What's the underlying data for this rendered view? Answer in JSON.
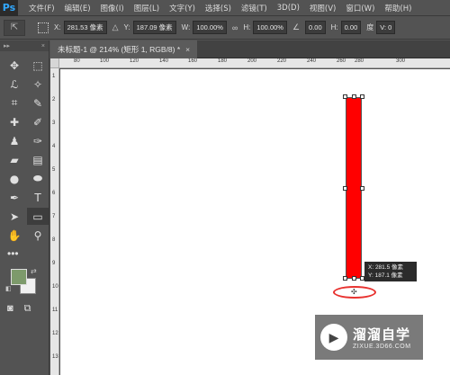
{
  "menubar": {
    "logo": "Ps",
    "items": [
      "文件(F)",
      "编辑(E)",
      "图像(I)",
      "图层(L)",
      "文字(Y)",
      "选择(S)",
      "滤镜(T)",
      "3D(D)",
      "视图(V)",
      "窗口(W)",
      "帮助(H)"
    ]
  },
  "options": {
    "x_label": "X:",
    "x_value": "281.53 像素",
    "delta_icon": "delta-icon",
    "y_label": "Y:",
    "y_value": "187.09 像素",
    "w_label": "W:",
    "w_value": "100.00%",
    "link_icon": "link-icon",
    "h_label": "H:",
    "h_value": "100.00%",
    "angle_icon": "angle-icon",
    "angle_value": "0.00",
    "skew_h_label": "H:",
    "skew_h_value": "0.00",
    "skew_v_label": "度",
    "skew_v_value": "V: 0"
  },
  "document": {
    "tab_title": "未标题-1 @ 214% (矩形 1, RGB/8) *",
    "tab_close": "×"
  },
  "ruler": {
    "h_ticks": [
      "80",
      "100",
      "120",
      "140",
      "160",
      "180",
      "200",
      "220",
      "240",
      "260",
      "280",
      "300"
    ],
    "v_ticks": [
      "1",
      "2",
      "3",
      "4",
      "5",
      "6",
      "7",
      "8",
      "9",
      "10",
      "11",
      "12",
      "13"
    ]
  },
  "canvas": {
    "tooltip_x": "X: 281.5 像素",
    "tooltip_y": "Y: 187.1 像素",
    "rect_color": "#ff0000",
    "highlight_color": "#e8322f"
  },
  "colors": {
    "foreground": "#7d9a6b",
    "background": "#f0f0f0"
  },
  "watermark": {
    "title": "溜溜自学",
    "subtitle": "ZIXUE.3D66.COM"
  }
}
